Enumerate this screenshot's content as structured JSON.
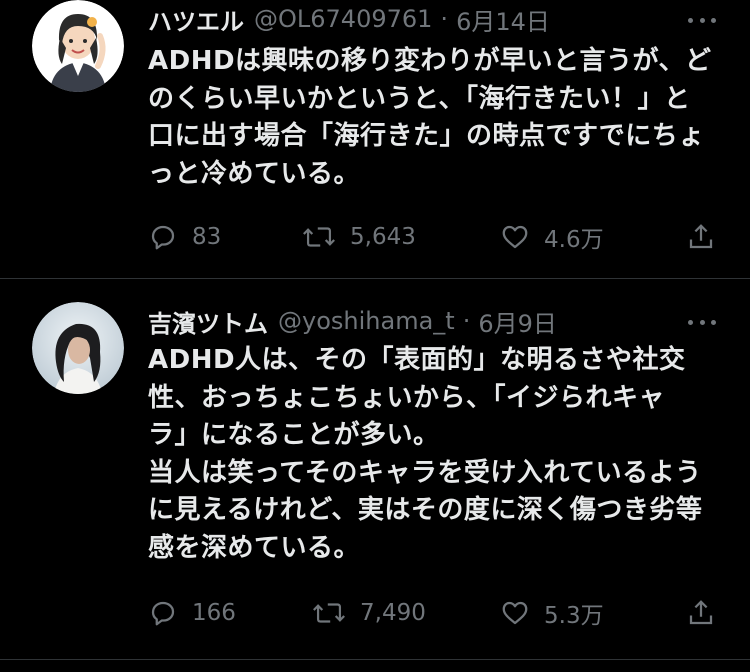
{
  "tweets": [
    {
      "name": "ハツエル",
      "handle": "@OL67409761",
      "separator": "·",
      "date": "6月14日",
      "text_lines": [
        "ADHDは興味の移り変わりが早いと言うが、ど",
        "のくらい早いかというと、「海行きたい！」と",
        "口に出す場合「海行きた」の時点ですでにちょ",
        "っと冷めている。"
      ],
      "replies": "83",
      "retweets": "5,643",
      "likes": "4.6万"
    },
    {
      "name": "吉濱ツトム",
      "handle": "@yoshihama_t",
      "separator": "·",
      "date": "6月9日",
      "text_lines": [
        "ADHD人は、その「表面的」な明るさや社交",
        "性、おっちょこちょいから、「イジられキャ",
        "ラ」になることが多い。",
        "当人は笑ってそのキャラを受け入れているよう",
        "に見えるけれど、実はその度に深く傷つき劣等",
        "感を深めている。"
      ],
      "replies": "166",
      "retweets": "7,490",
      "likes": "5.3万"
    }
  ],
  "icons": {
    "reply": "reply-icon",
    "retweet": "retweet-icon",
    "like": "heart-icon",
    "share": "share-icon",
    "more": "more-icon"
  },
  "colors": {
    "background": "#000000",
    "text": "#e7e9ea",
    "secondary": "#71767b",
    "divider": "#2f3336"
  }
}
